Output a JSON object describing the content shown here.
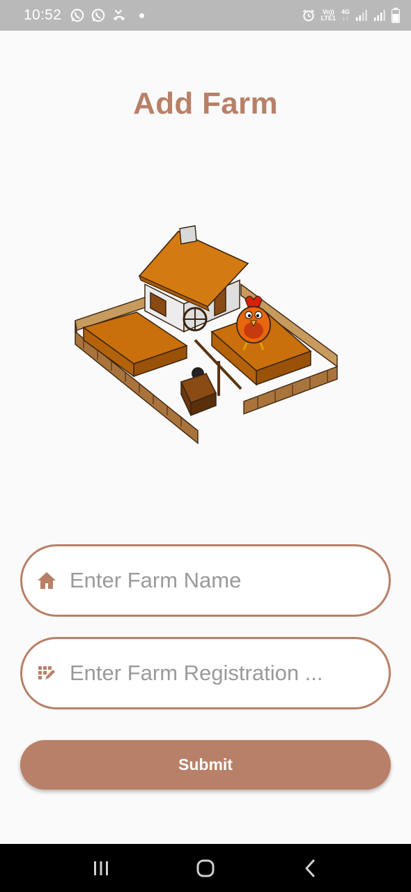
{
  "status_bar": {
    "time": "10:52",
    "left_icons": [
      "whatsapp-icon",
      "whatsapp-icon",
      "missed-call-icon"
    ],
    "right_icons": [
      "alarm-icon",
      "volte-lte-icon",
      "4g-data-icon",
      "signal-icon",
      "signal-icon",
      "battery-icon"
    ],
    "volte_label": "Vo))",
    "lte_label": "LTE1",
    "network_label": "4G"
  },
  "page": {
    "title": "Add Farm"
  },
  "form": {
    "farm_name": {
      "icon": "home-icon",
      "placeholder": "Enter Farm Name",
      "value": ""
    },
    "farm_registration": {
      "icon": "registration-icon",
      "placeholder": "Enter Farm Registration ...",
      "value": ""
    },
    "submit_label": "Submit"
  },
  "colors": {
    "accent": "#b88066",
    "status_bar": "#b9b9b9",
    "background": "#fafafa"
  },
  "nav_bar": {
    "buttons": [
      "recents-icon",
      "home-nav-icon",
      "back-icon"
    ]
  }
}
